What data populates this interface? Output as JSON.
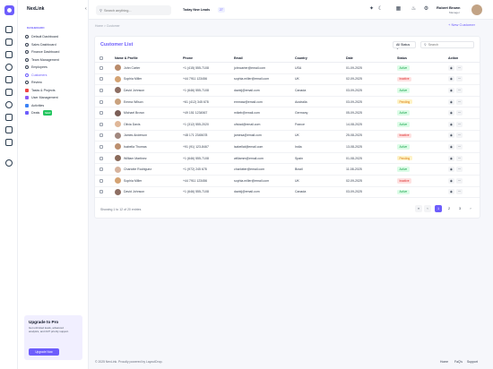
{
  "app": {
    "name": "NexLink"
  },
  "rail": {
    "icons": [
      "home-icon",
      "grid-icon",
      "users-icon",
      "target-icon",
      "mail-icon",
      "chart-icon",
      "settings-icon",
      "bell-icon",
      "calendar-icon",
      "bar-chart-icon",
      "plus-icon"
    ]
  },
  "sidebar": {
    "section_label": "DASHBOARD",
    "items": [
      {
        "label": "Default Dashboard",
        "icon": "dashboard-icon"
      },
      {
        "label": "Sales Dashboard",
        "icon": "sales-icon"
      },
      {
        "label": "Finance Dashboard",
        "icon": "finance-icon"
      },
      {
        "label": "Team Management",
        "icon": "team-icon"
      },
      {
        "label": "Employees",
        "icon": "employees-icon"
      },
      {
        "label": "Customers",
        "icon": "customers-icon",
        "active": true
      },
      {
        "label": "Review",
        "icon": "star-icon"
      },
      {
        "label": "Tasks & Projects",
        "icon": "tasks-icon",
        "color": "#ef4444"
      },
      {
        "label": "User Management",
        "icon": "user-mgmt-icon",
        "color": "#8b5cf6"
      },
      {
        "label": "Activities",
        "icon": "activities-icon",
        "color": "#3b82f6"
      },
      {
        "label": "Deals",
        "icon": "deals-icon",
        "color": "#6d5dfc",
        "badge": "NEW"
      }
    ],
    "promo": {
      "title": "Upgrade to Pro",
      "text": "Get unlimited leads, advanced analytics, and 24/7 priority support.",
      "button": "Upgrade Now"
    }
  },
  "topbar": {
    "search_placeholder": "Search anything...",
    "today_label": "Today New Leads",
    "today_count": "27",
    "user_name": "Robert Brown",
    "user_role": "Manager"
  },
  "breadcrumb": "Home  >  Customer",
  "new_customer_label": "+ New Customer",
  "customers": {
    "title": "Customer List",
    "filter_label": "All Status",
    "search_placeholder": "Search",
    "columns": [
      "Name & Profile",
      "Phone",
      "Email",
      "Country",
      "Date",
      "Status",
      "Action"
    ],
    "rows": [
      {
        "name": "John Carter",
        "phone": "+1 (415) 555-7108",
        "email": "johncarter@email.com",
        "country": "USA",
        "date": "01-09-2025",
        "status": "Active",
        "avatar": "#b98b6b"
      },
      {
        "name": "Sophia Miller",
        "phone": "+44 7911 123456",
        "email": "sophia.miller@email.com",
        "country": "UK",
        "date": "02-09-2025",
        "status": "Inactive",
        "avatar": "#d4a373"
      },
      {
        "name": "David Johnson",
        "phone": "+1 (646) 555-7108",
        "email": "davidj@email.com",
        "country": "Canada",
        "date": "03-09-2025",
        "status": "Active",
        "avatar": "#8d6e63"
      },
      {
        "name": "Emma Wilson",
        "phone": "+61 (412) 345 678",
        "email": "emmaw@email.com",
        "country": "Australia",
        "date": "03-09-2025",
        "status": "Pending",
        "avatar": "#c9a27e"
      },
      {
        "name": "Michael Brown",
        "phone": "+49 151 1234567",
        "email": "mikeb@email.com",
        "country": "Germany",
        "date": "05-09-2025",
        "status": "Active",
        "avatar": "#7b5e57"
      },
      {
        "name": "Olivia Davis",
        "phone": "+1 (312) 555-2020",
        "email": "oliviad@email.com",
        "country": "France",
        "date": "14-08-2025",
        "status": "Active",
        "avatar": "#e0b899"
      },
      {
        "name": "James Anderson",
        "phone": "+48 171 2345678",
        "email": "jamesa@email.com",
        "country": "UK",
        "date": "25-08-2025",
        "status": "Inactive",
        "avatar": "#a1887f"
      },
      {
        "name": "Isabella Thomas",
        "phone": "+91 (91) 123-8467",
        "email": "isabellat@email.com",
        "country": "India",
        "date": "13-08-2025",
        "status": "Active",
        "avatar": "#bc8f6f"
      },
      {
        "name": "William Martinez",
        "phone": "+1 (646) 555-7108",
        "email": "williamm@email.com",
        "country": "Spain",
        "date": "01-08-2025",
        "status": "Pending",
        "avatar": "#8a6a5a"
      },
      {
        "name": "Charlotte Rodriguez",
        "phone": "+1 (972) 245 678",
        "email": "charlotter@email.com",
        "country": "Brazil",
        "date": "11-08-2025",
        "status": "Active",
        "avatar": "#d7b49e"
      },
      {
        "name": "Sophia Miller",
        "phone": "+44 7911 123456",
        "email": "sophia.miller@email.com",
        "country": "UK",
        "date": "02-09-2025",
        "status": "Inactive",
        "avatar": "#d4a373"
      },
      {
        "name": "David Johnson",
        "phone": "+1 (646) 555-7108",
        "email": "davidj@email.com",
        "country": "Canada",
        "date": "03-09-2025",
        "status": "Active",
        "avatar": "#8d6e63"
      }
    ],
    "showing": "Showing 1 to 12 of 20 entries",
    "pages": [
      "1",
      "2",
      "3"
    ],
    "current_page": "1"
  },
  "footer": {
    "copyright": "© 2025 NexLink. Proudly powered by LayoutDrop.",
    "links": [
      "Home",
      "FaQ's",
      "Support"
    ]
  },
  "colors": {
    "accent": "#6d5dfc",
    "active": "#16a34a",
    "inactive": "#dc2626",
    "pending": "#d97706"
  }
}
